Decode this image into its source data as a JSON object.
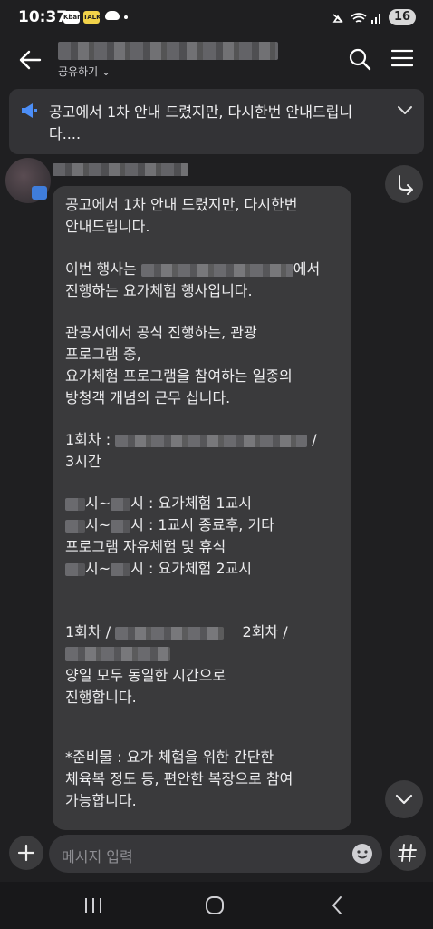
{
  "status_bar": {
    "time": "10:37",
    "badges": [
      "Kbank",
      "TALK"
    ],
    "battery": "16"
  },
  "header": {
    "share_label": "공유하기"
  },
  "notice": {
    "text": "공고에서 1차 안내 드렸지만, 다시한번 안내드립니다...."
  },
  "message": {
    "line1": "공고에서 1차 안내 드렸지만, 다시한번",
    "line2": "안내드립니다.",
    "line3_suffix": "에서",
    "line4": "진행하는 요가체험 행사입니다.",
    "line5": "관공서에서 공식 진행하는, 관광",
    "line6": "프로그램 중,",
    "line7": "요가체험 프로그램을 참여하는 일종의",
    "line8": "방청객 개념의 근무 십니다.",
    "line9_prefix": "1회차 :",
    "line9_suffix": "/",
    "line10": "3시간",
    "line11_mid": "시~",
    "line11_end": "시 : 요가체험 1교시",
    "line12_mid": "시~",
    "line12_end": "시 : 1교시 종료후, 기타",
    "line13": "프로그램 자유체험 및 휴식",
    "line14_mid": "시~",
    "line14_end": "시 : 요가체험 2교시",
    "line15_a": "1회차 /",
    "line15_b": "2회차 /",
    "line16": "양일 모두 동일한 시간으로",
    "line17": "진행합니다.",
    "line18": "*준비물 : 요가 체험을 위한 간단한",
    "line19": "체육복 정도 등, 편안한 복장으로 참여",
    "line20": "가능합니다."
  },
  "input": {
    "placeholder": "메시지 입력"
  },
  "icons": [
    "back-arrow-icon",
    "search-icon",
    "menu-icon",
    "megaphone-icon",
    "chevron-down-icon",
    "share-icon",
    "plus-icon",
    "emoji-icon",
    "hash-icon",
    "recent-apps-icon",
    "home-icon",
    "back-nav-icon"
  ]
}
